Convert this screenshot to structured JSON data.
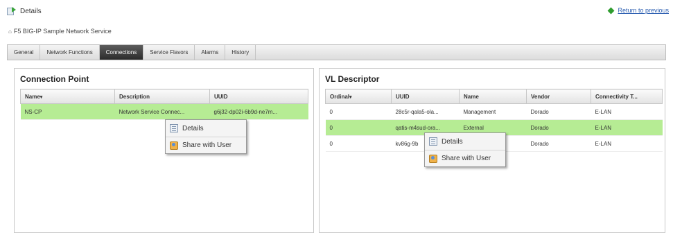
{
  "header": {
    "title": "Details",
    "return_link": "Return to previous",
    "subtitle": "F5 BIG-IP Sample Network Service",
    "home_glyph": "⌂"
  },
  "tabs": [
    {
      "label": "General",
      "active": false
    },
    {
      "label": "Network Functions",
      "active": false
    },
    {
      "label": "Connections",
      "active": true
    },
    {
      "label": "Service Flavors",
      "active": false
    },
    {
      "label": "Alarms",
      "active": false
    },
    {
      "label": "History",
      "active": false
    }
  ],
  "connection_point": {
    "title": "Connection Point",
    "sort_glyph": "▾",
    "columns": [
      "Name",
      "Description",
      "UUID"
    ],
    "rows": [
      {
        "name": "NS-CP",
        "description": "Network Service Connec...",
        "uuid": "g6j32-dp02i-6b9d-ne7m..."
      }
    ],
    "context_menu": [
      "Details",
      "Share with User"
    ]
  },
  "vl_descriptor": {
    "title": "VL Descriptor",
    "sort_glyph": "▾",
    "columns": [
      "Ordinal",
      "UUID",
      "Name",
      "Vendor",
      "Connectivity T..."
    ],
    "rows": [
      {
        "ordinal": "0",
        "uuid": "28c5r-qala5-ola...",
        "name": "Management",
        "vendor": "Dorado",
        "connectivity": "E-LAN"
      },
      {
        "ordinal": "0",
        "uuid": "qatis-m4sud-ora...",
        "name": "External",
        "vendor": "Dorado",
        "connectivity": "E-LAN"
      },
      {
        "ordinal": "0",
        "uuid": "kv86g-9b",
        "name": "",
        "vendor": "Dorado",
        "connectivity": "E-LAN"
      }
    ],
    "context_menu": [
      "Details",
      "Share with User"
    ]
  },
  "colors": {
    "selected_row": "#b6ec94",
    "active_tab": "#2b2b2b",
    "link": "#2a5db0",
    "return_bullet": "#2e9c2e"
  },
  "icons": [
    "details-page-icon",
    "return-bullet-icon",
    "home-icon",
    "sort-desc-icon",
    "details-menu-icon",
    "share-user-icon"
  ]
}
